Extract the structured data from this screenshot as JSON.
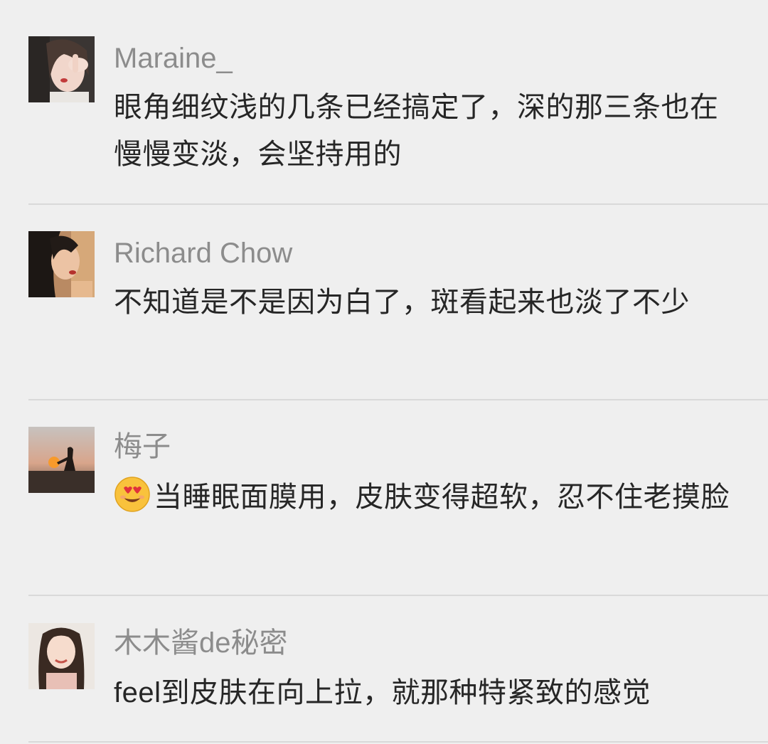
{
  "comments": [
    {
      "name": "Maraine_",
      "text": "眼角细纹浅的几条已经搞定了，深的那三条也在慢慢变淡，会坚持用的",
      "avatar_icon": "avatar-photo-woman-hand-on-face"
    },
    {
      "name": "Richard Chow",
      "text": "不知道是不是因为白了，斑看起来也淡了不少",
      "avatar_icon": "avatar-photo-woman-profile"
    },
    {
      "name": "梅子",
      "text": "当睡眠面膜用，皮肤变得超软，忍不住老摸脸",
      "emoji": "smiling-face-with-heart-eyes-emoji",
      "avatar_icon": "avatar-photo-sunset-silhouette"
    },
    {
      "name": "木木酱de秘密",
      "text": "feel到皮肤在向上拉，就那种特紧致的感觉",
      "avatar_icon": "avatar-photo-woman-smiling"
    }
  ]
}
